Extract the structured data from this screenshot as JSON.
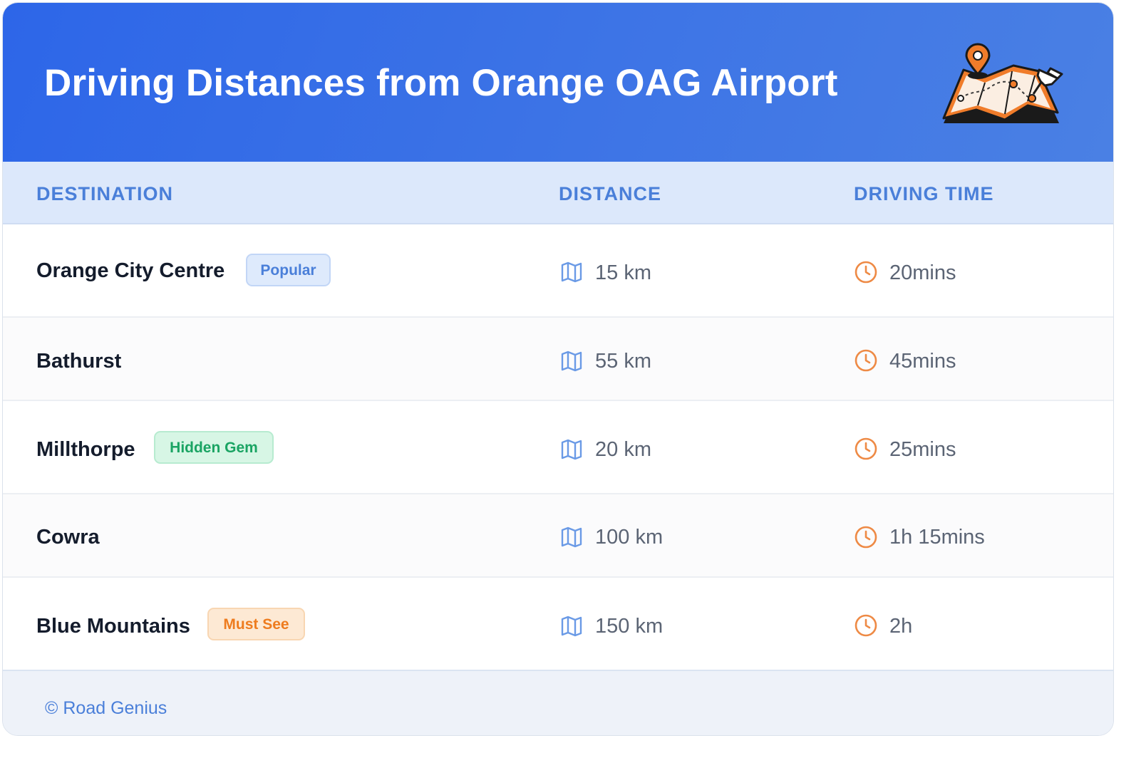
{
  "header": {
    "title": "Driving Distances from Orange OAG Airport",
    "illustration_icon": "map-with-pins-icon"
  },
  "table": {
    "columns": [
      "DESTINATION",
      "DISTANCE",
      "DRIVING TIME"
    ],
    "rows": [
      {
        "destination": "Orange City Centre",
        "badge": "Popular",
        "distance": "15 km",
        "time": "20mins"
      },
      {
        "destination": "Bathurst",
        "badge": "",
        "distance": "55 km",
        "time": "45mins"
      },
      {
        "destination": "Millthorpe",
        "badge": "Hidden Gem",
        "distance": "20 km",
        "time": "25mins"
      },
      {
        "destination": "Cowra",
        "badge": "",
        "distance": "100 km",
        "time": "1h 15mins"
      },
      {
        "destination": "Blue Mountains",
        "badge": "Must See",
        "distance": "150 km",
        "time": "2h"
      }
    ],
    "distance_icon": "map-icon",
    "time_icon": "clock-icon"
  },
  "footer": {
    "credit": "© Road Genius"
  },
  "colors": {
    "header_blue": "#2d66e8",
    "accent_blue": "#4a7fd9",
    "clock_orange": "#ee8a45",
    "popular": "#4a7fd9",
    "hidden_gem": "#1aa463",
    "must_see": "#ee7c1f"
  }
}
